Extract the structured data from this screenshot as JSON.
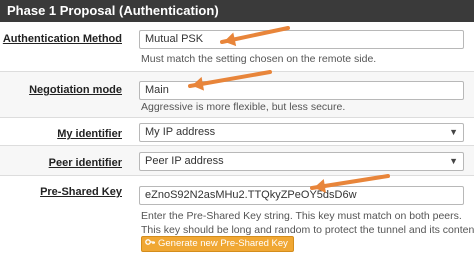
{
  "panel": {
    "title": "Phase 1 Proposal (Authentication)"
  },
  "fields": {
    "auth_method": {
      "label": "Authentication Method",
      "value": "Mutual PSK",
      "help": "Must match the setting chosen on the remote side."
    },
    "negotiation_mode": {
      "label": "Negotiation mode",
      "value": "Main",
      "help": "Aggressive is more flexible, but less secure."
    },
    "my_identifier": {
      "label": "My identifier",
      "value": "My IP address"
    },
    "peer_identifier": {
      "label": "Peer identifier",
      "value": "Peer IP address"
    },
    "psk": {
      "label": "Pre-Shared Key",
      "value": "eZnoS92N2asMHu2.TTQkyZPeOY5dsD6w",
      "help_line1": "Enter the Pre-Shared Key string. This key must match on both peers.",
      "help_line2": "This key should be long and random to protect the tunnel and its contents. A",
      "generate_button": "Generate new Pre-Shared Key"
    }
  },
  "annotations": {
    "arrow_color": "#e8853a"
  },
  "icons": {
    "select_caret": "caret-down-icon",
    "generate_key": "key-icon"
  }
}
